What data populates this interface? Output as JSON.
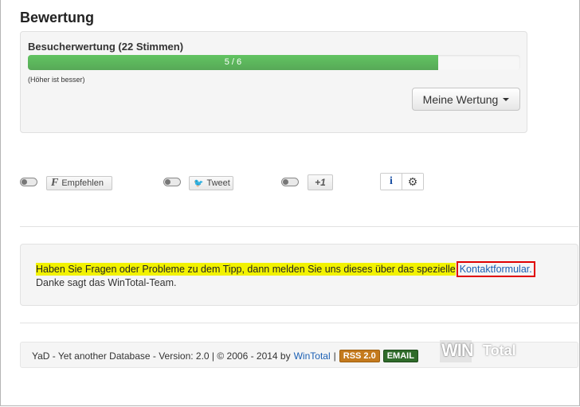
{
  "section": {
    "title": "Bewertung"
  },
  "rating": {
    "label": "Besucherwertung (22 Stimmen)",
    "progress_text": "5 / 6",
    "progress_fraction": 0.833,
    "hint": "(Höher ist besser)",
    "my_rating_label": "Meine Wertung"
  },
  "share": {
    "facebook_label": "Empfehlen",
    "twitter_label": "Tweet",
    "gplus_label": "+1",
    "info_icon": "i",
    "settings_icon": "⚙"
  },
  "notice": {
    "text": "Haben Sie Fragen oder Probleme zu dem Tipp, dann melden Sie uns dieses über das spezielle",
    "link": "Kontaktformular.",
    "thanks": "Danke sagt das WinTotal-Team."
  },
  "footer": {
    "text": "YaD - Yet another Database - Version: 2.0 | © 2006 - 2014 by",
    "link": "WinTotal",
    "separator": "|",
    "rss_badge": "RSS 2.0",
    "email_badge": "EMAIL",
    "logo_text_a": "WIN",
    "logo_text_b": "Total"
  },
  "colors": {
    "progress_green": "#5eb95e",
    "link_blue": "#1a5fb4",
    "highlight_yellow": "#f2f200",
    "highlight_border_red": "#e00000"
  }
}
